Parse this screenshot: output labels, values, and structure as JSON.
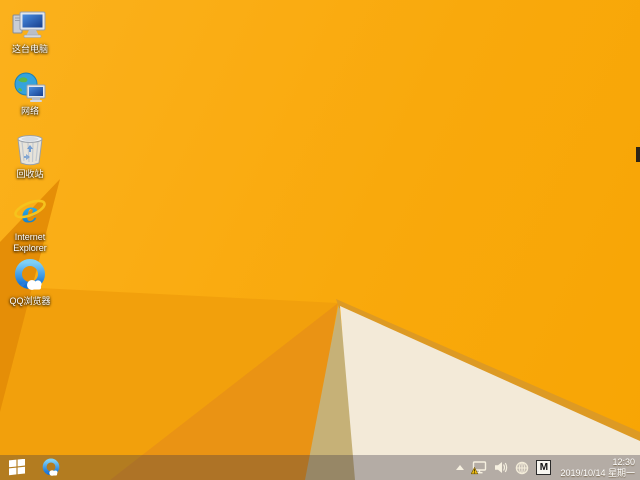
{
  "desktop": {
    "icons": [
      {
        "id": "this-pc",
        "label": "这台电脑"
      },
      {
        "id": "network",
        "label": "网络"
      },
      {
        "id": "recycle-bin",
        "label": "回收站"
      },
      {
        "id": "internet-explorer",
        "label": "Internet Explorer"
      },
      {
        "id": "qq-browser",
        "label": "QQ浏览器"
      }
    ],
    "wallpaper": {
      "style": "windows-8.1-default-faceted",
      "main_color": "#F8A807",
      "medium_facet": "#F2A00C",
      "deep_facet": "#EA9314",
      "dark_wedge": "#E58E07",
      "shadow_facet": "#C6B177",
      "cream_facet": "#F3EAD8",
      "edge_highlight": "#DD9A24"
    }
  },
  "taskbar": {
    "tint": "rgba(63,57,72,0.35)",
    "start_icon": "windows-logo-icon",
    "pinned_apps": [
      {
        "id": "qq-browser-taskbar",
        "icon": "qq-browser-icon"
      }
    ],
    "tray": {
      "icons": [
        "hidden-icons-chevron",
        "network-warning-icon",
        "volume-icon",
        "sphere-input-icon",
        "ime-mode-box"
      ],
      "ime_indicator": "M",
      "time": "12:30",
      "date": "2019/10/14 星期一"
    }
  }
}
